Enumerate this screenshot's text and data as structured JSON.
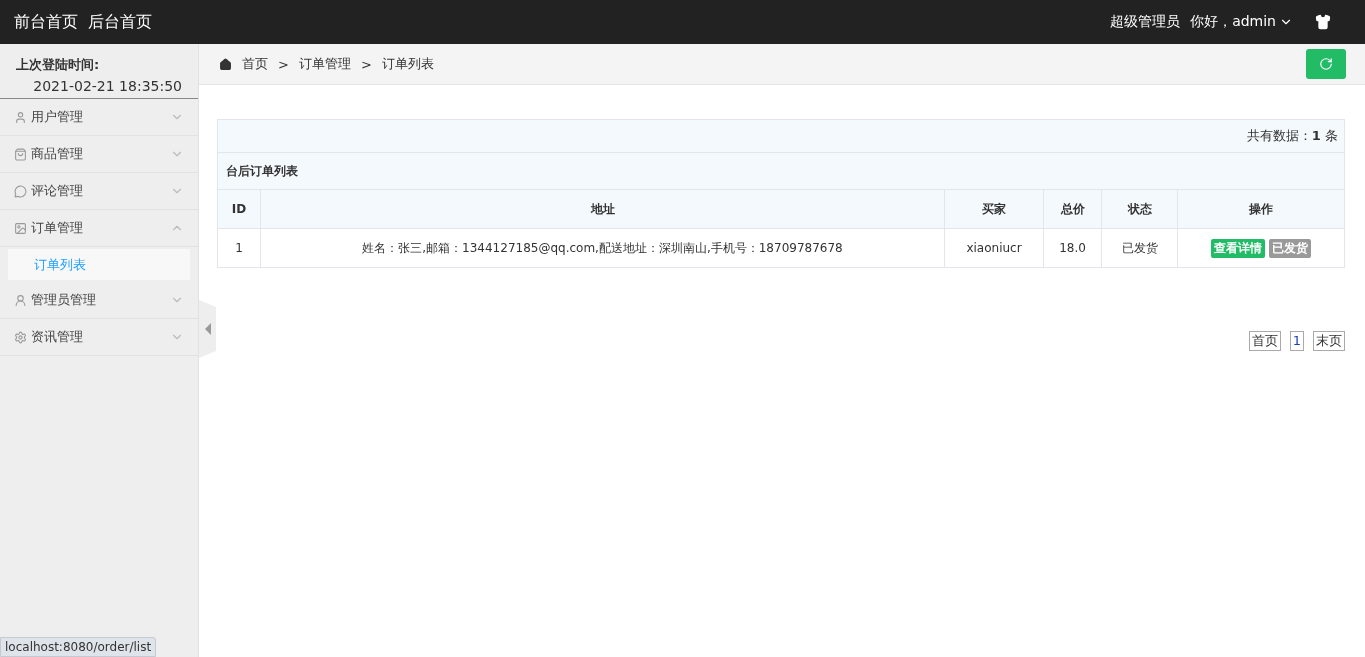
{
  "topbar": {
    "links": [
      "前台首页",
      "后台首页"
    ],
    "role": "超级管理员",
    "greeting": "你好，admin"
  },
  "sidebar": {
    "last_login_label": "上次登陆时间:",
    "last_login_time": "2021-02-21 18:35:50",
    "items": [
      {
        "label": "用户管理",
        "expanded": false
      },
      {
        "label": "商品管理",
        "expanded": false
      },
      {
        "label": "评论管理",
        "expanded": false
      },
      {
        "label": "订单管理",
        "expanded": true,
        "children": [
          {
            "label": "订单列表",
            "selected": true
          }
        ]
      },
      {
        "label": "管理员管理",
        "expanded": false
      },
      {
        "label": "资讯管理",
        "expanded": false
      }
    ]
  },
  "breadcrumb": [
    {
      "label": "首页"
    },
    {
      "separator": ">",
      "label": "订单管理"
    },
    {
      "separator": ">",
      "label": "订单列表"
    }
  ],
  "summary": "共有数据：**1** 条",
  "table": {
    "title": "台后订单列表",
    "columns": [
      "ID",
      "地址",
      "买家",
      "总价",
      "状态",
      "操作"
    ],
    "rows": [
      {
        "cells": [
          "1",
          "姓名：张三,邮箱：1344127185@qq.com,配送地址：深圳南山,手机号：18709787678",
          "xiaoniucr",
          "18.0",
          "已发货"
        ],
        "actions": [
          {
            "label": "查看详情",
            "kind": "primary"
          },
          {
            "label": "已发货",
            "kind": "muted"
          }
        ]
      }
    ]
  },
  "pagination": [
    {
      "label": "首页",
      "selected": false
    },
    {
      "label": "1",
      "selected": true
    },
    {
      "label": "末页",
      "selected": false
    }
  ],
  "status_url": "localhost:8080/order/list"
}
